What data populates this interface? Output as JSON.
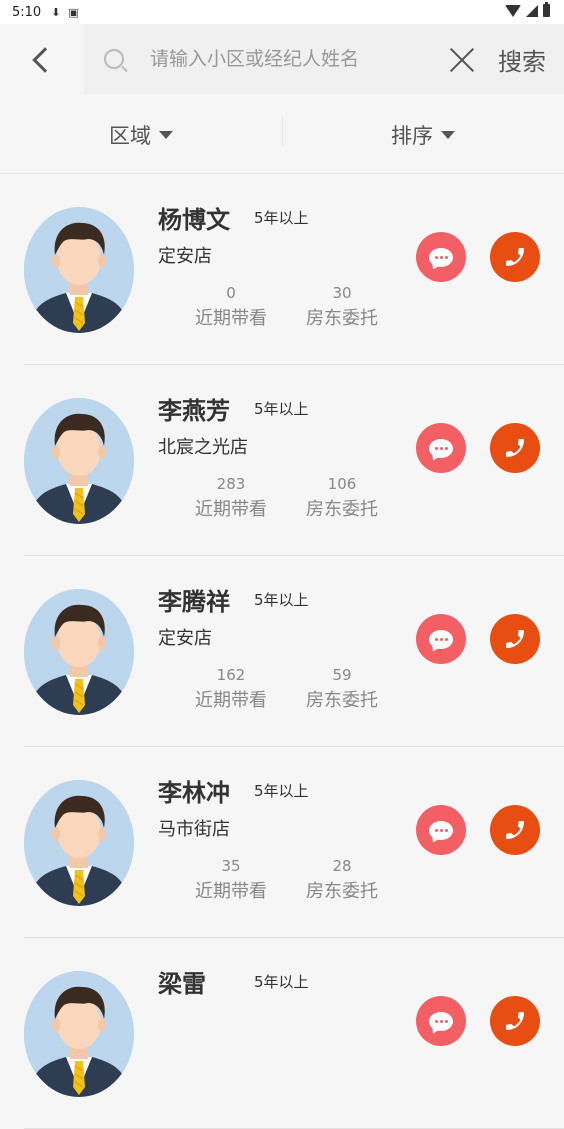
{
  "status": {
    "time": "5:10"
  },
  "search": {
    "placeholder": "请输入小区或经纪人姓名",
    "value": "",
    "button_label": "搜索"
  },
  "filters": [
    {
      "label": "区域"
    },
    {
      "label": "排序"
    }
  ],
  "agents": [
    {
      "name": "杨博文",
      "years": "5年以上",
      "store": "定安店",
      "viewings": "0",
      "viewings_label": "近期带看",
      "entrusts": "30",
      "entrusts_label": "房东委托"
    },
    {
      "name": "李燕芳",
      "years": "5年以上",
      "store": "北宸之光店",
      "viewings": "283",
      "viewings_label": "近期带看",
      "entrusts": "106",
      "entrusts_label": "房东委托"
    },
    {
      "name": "李腾祥",
      "years": "5年以上",
      "store": "定安店",
      "viewings": "162",
      "viewings_label": "近期带看",
      "entrusts": "59",
      "entrusts_label": "房东委托"
    },
    {
      "name": "李林冲",
      "years": "5年以上",
      "store": "马市街店",
      "viewings": "35",
      "viewings_label": "近期带看",
      "entrusts": "28",
      "entrusts_label": "房东委托"
    },
    {
      "name": "梁雷",
      "years": "5年以上",
      "store": "",
      "viewings": "",
      "viewings_label": "",
      "entrusts": "",
      "entrusts_label": ""
    }
  ],
  "colors": {
    "chat": "#f26066",
    "call": "#e84d12",
    "avatar_bg": "#bcd6ee"
  }
}
